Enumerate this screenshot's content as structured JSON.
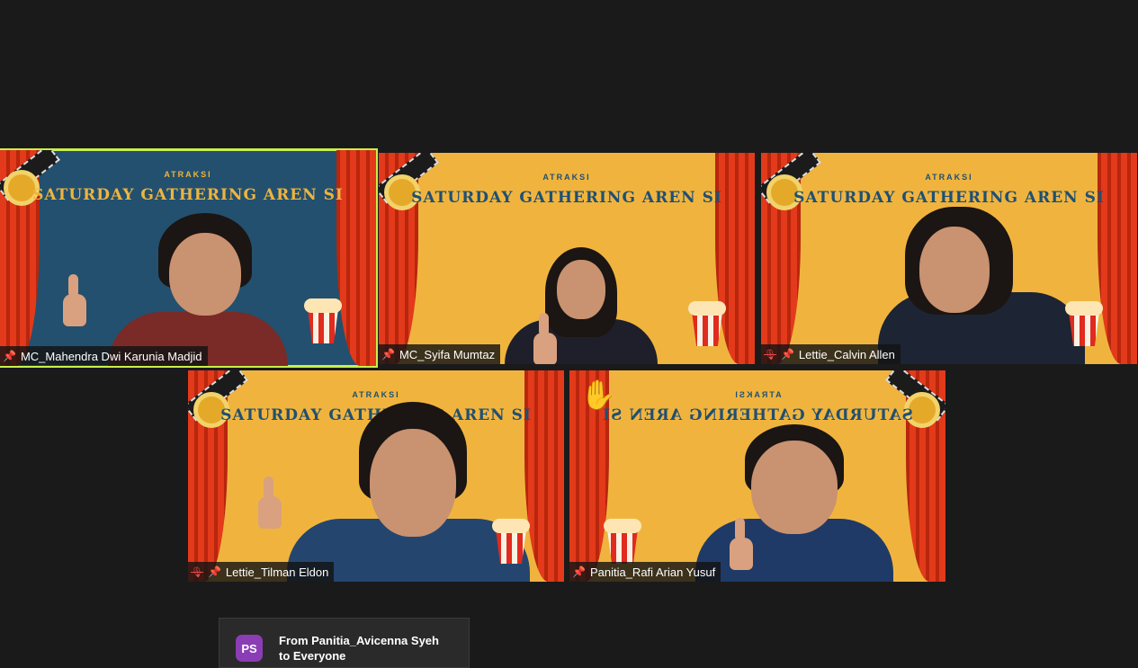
{
  "tiles": [
    {
      "name": "MC_Mahendra Dwi Karunia Madjid",
      "banner_small": "ATRAKSI",
      "banner_big": "SATURDAY GATHERING AREN SI",
      "muted": false
    },
    {
      "name": "MC_Syifa Mumtaz",
      "banner_small": "ATRAKSI",
      "banner_big": "SATURDAY GATHERING AREN SI",
      "muted": false
    },
    {
      "name": "Lettie_Calvin Allen",
      "banner_small": "ATRAKSI",
      "banner_big": "SATURDAY GATHERING AREN SI",
      "muted": true
    },
    {
      "name": "Lettie_Tilman Eldon",
      "banner_small": "ATRAKSI",
      "banner_big": "SATURDAY GATHERING AREN SI",
      "muted": true
    },
    {
      "name": "Panitia_Rafi Arian Yusuf",
      "banner_small": "ATRAKSI",
      "banner_big": "SATURDAY GATHERING AREN SI",
      "muted": false,
      "reaction": "✋"
    }
  ],
  "chat_toast": {
    "avatar_initials": "PS",
    "from_line": "From Panitia_Avicenna Syeh",
    "to_line": "to Everyone"
  },
  "icons": {
    "pin": "pin-icon",
    "mute": "muted-mic-icon",
    "raise_hand": "raised-hand-icon"
  },
  "colors": {
    "background": "#1a1a1a",
    "active_speaker_border": "#c8f04a",
    "avatar": "#8a3db4"
  }
}
